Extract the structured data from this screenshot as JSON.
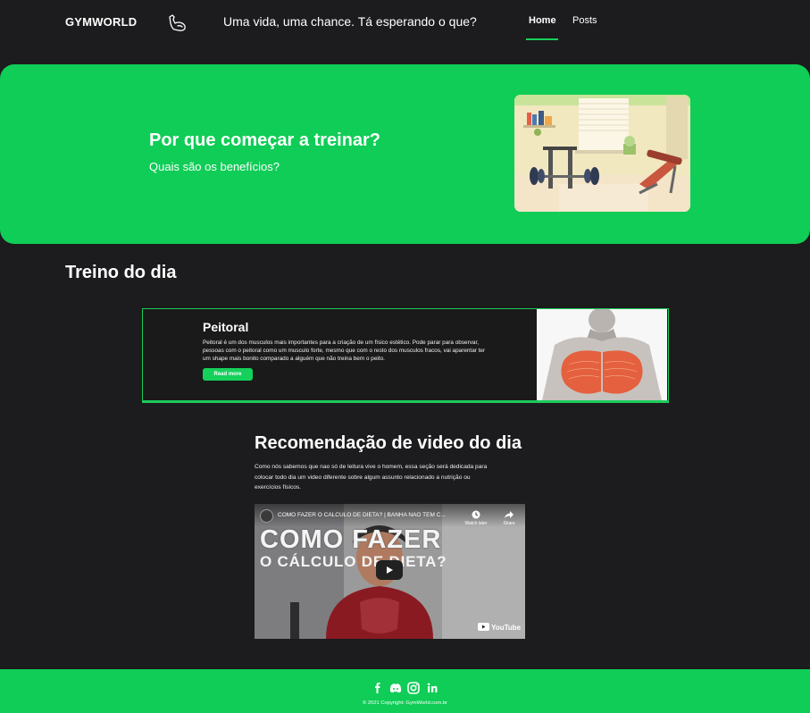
{
  "navbar": {
    "brand": "GYMWORLD",
    "brand_icon": "flexed-arm-icon",
    "tagline": "Uma vida, uma chance. Tá esperando o que?",
    "links": [
      {
        "label": "Home",
        "active": true
      },
      {
        "label": "Posts",
        "active": false
      }
    ]
  },
  "hero": {
    "title": "Por que começar a treinar?",
    "subtitle": "Quais são os benefícios?",
    "image": "home-gym-illustration"
  },
  "treino": {
    "title": "Treino do dia",
    "card": {
      "title": "Peitoral",
      "text": "Peitoral é um dos musculos mais importantes para a criação de um físico estético. Pode parar para observar, pessoas com o peitoral como um musculo forte, mesmo que com o resto dos musculos fracos, vai aparentar ter um shape mais bonito comparado a alguém que não treina bem o peito.",
      "button": "Read more",
      "image": "chest-muscle-anatomy"
    }
  },
  "video_section": {
    "title": "Recomendação de video do dia",
    "description": "Como nós sabemos que nao só de leitura vive o homem, essa seção será dedicada para colocar todo dia um video diferente sobre algum assunto relacionado a nutrição ou exercícios físicos.",
    "video": {
      "title": "COMO FAZER O CÁLCULO DE DIETA? | BANHA NÃO TEM C...",
      "watch_later": "Watch later",
      "share": "Share",
      "thumb_line1": "COMO     FAZER",
      "thumb_line2": "O CÁLCULO    DE DIETA?",
      "platform": "YouTube"
    }
  },
  "footer": {
    "social": [
      "facebook-icon",
      "discord-icon",
      "instagram-icon",
      "linkedin-icon"
    ],
    "copyright": "© 2021 Copyright: GymWorld.com.br"
  },
  "colors": {
    "accent": "#0fcd56",
    "background": "#1c1b1d"
  }
}
